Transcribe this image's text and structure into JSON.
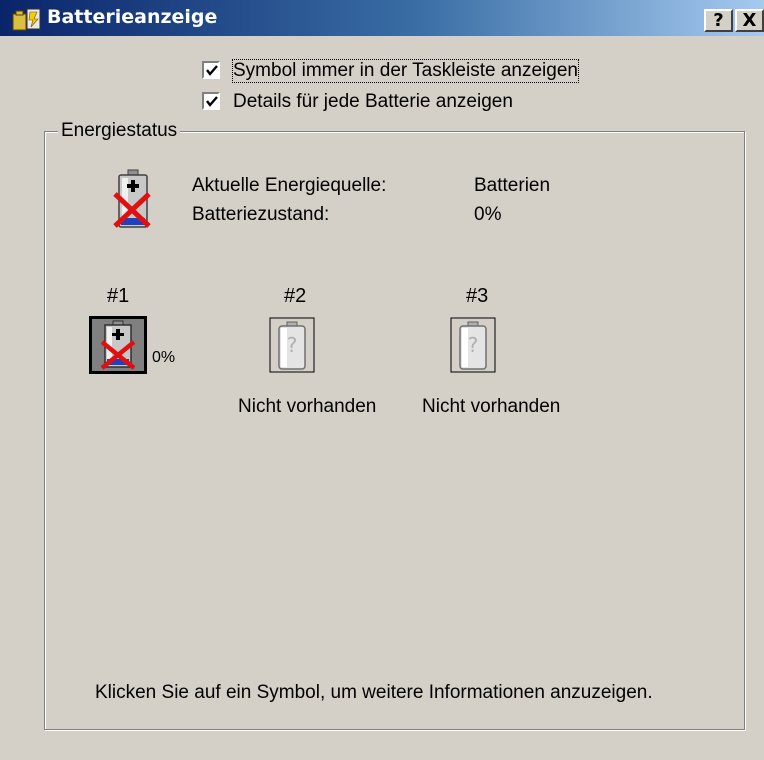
{
  "window": {
    "title": "Batterieanzeige",
    "help_button": "?",
    "close_button": "X"
  },
  "options": {
    "show_in_taskbar": {
      "label": "Symbol immer in der Taskleiste anzeigen",
      "checked": true
    },
    "show_details": {
      "label": "Details für jede Batterie anzeigen",
      "checked": true
    }
  },
  "energy_status": {
    "group_label": "Energiestatus",
    "current_source_label": "Aktuelle Energiequelle:",
    "current_source_value": "Batterien",
    "battery_state_label": "Batteriezustand:",
    "battery_state_value": "0%"
  },
  "batteries": [
    {
      "number": "#1",
      "status": "0%",
      "icon": "battery-empty-critical-icon"
    },
    {
      "number": "#2",
      "status": "Nicht vorhanden",
      "icon": "battery-absent-icon"
    },
    {
      "number": "#3",
      "status": "Nicht vorhanden",
      "icon": "battery-absent-icon"
    }
  ],
  "footer_hint": "Klicken Sie auf ein Symbol, um weitere Informationen anzuzeigen.",
  "colors": {
    "dialog_bg": "#d4d0c8",
    "title_gradient_start": "#0a246a",
    "title_gradient_end": "#a6caf0",
    "critical_cross": "#e01010",
    "battery_fill": "#2040c0"
  }
}
